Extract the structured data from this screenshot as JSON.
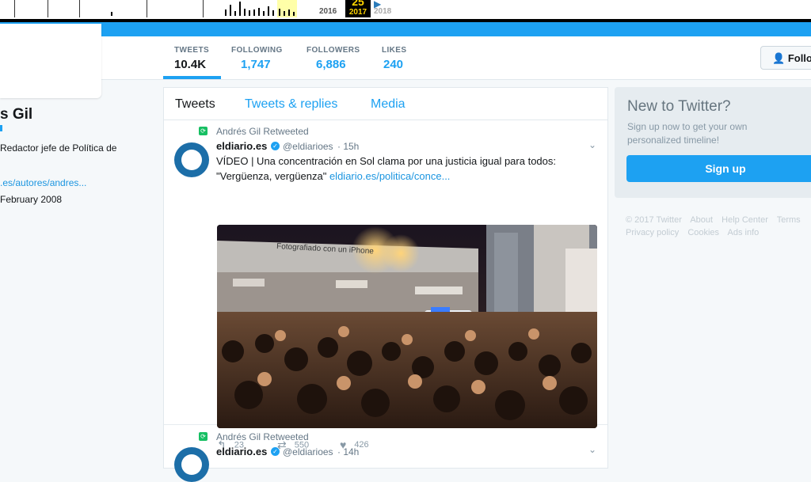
{
  "wayback": {
    "years": [
      "2016",
      "2017",
      "2018"
    ],
    "current_year": "2017",
    "current_day": "25"
  },
  "profile": {
    "name": "s Gil",
    "bio": "Redactor jefe de Política de",
    "link": ".es/autores/andres...",
    "joined": "February 2008"
  },
  "nav": {
    "stats": [
      {
        "label": "TWEETS",
        "value": "10.4K"
      },
      {
        "label": "FOLLOWING",
        "value": "1,747"
      },
      {
        "label": "FOLLOWERS",
        "value": "6,886"
      },
      {
        "label": "LIKES",
        "value": "240"
      }
    ],
    "follow_label": "Follo"
  },
  "tabs": [
    "Tweets",
    "Tweets & replies",
    "Media"
  ],
  "tweets": [
    {
      "retweeted_by": "Andrés Gil Retweeted",
      "name": "eldiario.es",
      "handle": "@eldiarioes",
      "time": "· 15h",
      "text": "VÍDEO | Una concentración en Sol clama por una justicia igual para todos: \"Vergüenza, vergüenza\"",
      "link": "eldiario.es/politica/conce...",
      "photo_caption": "Fotografiado con un iPhone",
      "actions": {
        "replies": "23",
        "retweets": "550",
        "likes": "426"
      }
    },
    {
      "retweeted_by": "Andrés Gil Retweeted",
      "name": "eldiario.es",
      "handle": "@eldiarioes",
      "time": "· 14h"
    }
  ],
  "sidebar": {
    "title": "New to Twitter?",
    "subtitle": "Sign up now to get your own personalized timeline!",
    "signup_label": "Sign up",
    "footer": [
      "© 2017 Twitter",
      "About",
      "Help Center",
      "Terms",
      "Privacy policy",
      "Cookies",
      "Ads info"
    ]
  },
  "colors": {
    "accent": "#1da1f2",
    "retweet": "#17bf63"
  }
}
